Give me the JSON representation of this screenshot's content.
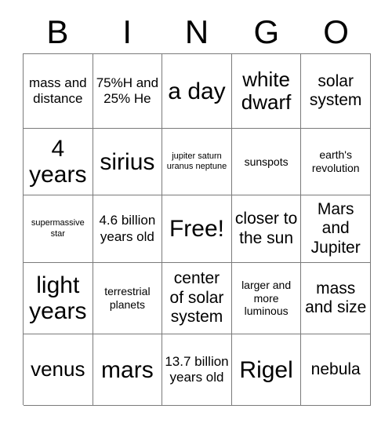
{
  "card": {
    "title": "BINGO",
    "header_letters": [
      "B",
      "I",
      "N",
      "G",
      "O"
    ],
    "free_space_label": "Free!",
    "grid_line_color": "#7a7a7a",
    "text_color": "#000000",
    "background_color": "#ffffff",
    "rows": 5,
    "columns": 5,
    "cells": [
      [
        {
          "text": "mass and distance",
          "size": "md"
        },
        {
          "text": "75%H and 25% He",
          "size": "md"
        },
        {
          "text": "a day",
          "size": "xxl"
        },
        {
          "text": "white dwarf",
          "size": "xl"
        },
        {
          "text": "solar system",
          "size": "lg"
        }
      ],
      [
        {
          "text": "4 years",
          "size": "xxl"
        },
        {
          "text": "sirius",
          "size": "xxl"
        },
        {
          "text": "jupiter saturn uranus neptune",
          "size": "xs"
        },
        {
          "text": "sunspots",
          "size": "sm"
        },
        {
          "text": "earth's revolution",
          "size": "sm"
        }
      ],
      [
        {
          "text": "supermassive star",
          "size": "xs"
        },
        {
          "text": "4.6 billion years old",
          "size": "md"
        },
        {
          "text": "Free!",
          "size": "xxl"
        },
        {
          "text": "closer to the sun",
          "size": "lg"
        },
        {
          "text": "Mars and Jupiter",
          "size": "lg"
        }
      ],
      [
        {
          "text": "light years",
          "size": "xxl"
        },
        {
          "text": "terrestrial planets",
          "size": "sm"
        },
        {
          "text": "center of solar system",
          "size": "lg"
        },
        {
          "text": "larger and more luminous",
          "size": "sm"
        },
        {
          "text": "mass and size",
          "size": "lg"
        }
      ],
      [
        {
          "text": "venus",
          "size": "xl"
        },
        {
          "text": "mars",
          "size": "xxl"
        },
        {
          "text": "13.7 billion years old",
          "size": "md"
        },
        {
          "text": "Rigel",
          "size": "xxl"
        },
        {
          "text": "nebula",
          "size": "lg"
        }
      ]
    ]
  }
}
